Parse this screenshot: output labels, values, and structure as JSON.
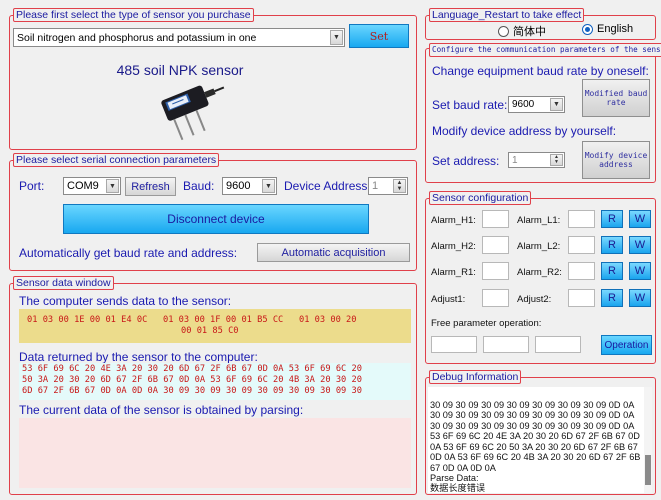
{
  "sensor_type_group": {
    "title": "Please first select the type of sensor you purchase",
    "sensor_select_value": "Soil nitrogen and phosphorus and potassium in one",
    "set_button": "Set",
    "sensor_name": "485 soil NPK sensor"
  },
  "serial_group": {
    "title": "Please select serial connection parameters",
    "port_label": "Port:",
    "port_value": "COM9",
    "refresh_button": "Refresh",
    "baud_label": "Baud:",
    "baud_value": "9600",
    "device_address_label": "Device Address:",
    "device_address_value": "1",
    "disconnect_button": "Disconnect device",
    "auto_label": "Automatically get baud rate and address:",
    "auto_button": "Automatic acquisition"
  },
  "data_window": {
    "title": "Sensor data window",
    "sent_label": "The computer sends data to the sensor:",
    "sent_line1": "01 03 00 1E 00 01 E4 0C   01 03 00 1F 00 01 B5 CC   01 03 00 20",
    "sent_line2": "00 01 85 C0",
    "returned_label": "Data returned by the sensor to the computer:",
    "returned_line1": "53 6F 69 6C 20 4E 3A 20 30 20 6D 67 2F 6B 67 0D 0A 53 6F 69 6C 20",
    "returned_line2": "50 3A 20 30 20 6D 67 2F 6B 67 0D 0A 53 6F 69 6C 20 4B 3A 20 30 20",
    "returned_line3": "6D 67 2F 6B 67 0D 0A 0D 0A 30 09 30 09 30 09 30 09 30 09 30 09 30",
    "parsed_label": "The current data of the sensor is obtained by parsing:"
  },
  "language_group": {
    "title": "Language_Restart to take effect",
    "option_chinese": "简体中",
    "option_english": "English",
    "selected": "English"
  },
  "comm_group": {
    "title": "Configure the communication parameters of the sensor",
    "baud_heading": "Change equipment baud rate by oneself:",
    "set_baud_label": "Set baud rate:",
    "set_baud_value": "9600",
    "modify_baud_button": "Modified baud rate",
    "address_heading": "Modify device address by yourself:",
    "set_address_label": "Set address:",
    "set_address_value": "1",
    "modify_address_button": "Modify device address"
  },
  "config_group": {
    "title": "Sensor configuration",
    "alarm_h1": "Alarm_H1:",
    "alarm_l1": "Alarm_L1:",
    "alarm_h2": "Alarm_H2:",
    "alarm_l2": "Alarm_L2:",
    "alarm_r1": "Alarm_R1:",
    "alarm_r2": "Alarm_R2:",
    "adjust1": "Adjust1:",
    "adjust2": "Adjust2:",
    "r_label": "R",
    "w_label": "W",
    "free_param_label": "Free parameter operation:",
    "operation_button": "Operation"
  },
  "debug_group": {
    "title": "Debug Information",
    "lines": [
      "30 09 30 09 30 09 30 09 30 09 30 09 30 09 0D 0A",
      "30 09 30 09 30 09 30 09 30 09 30 09 30 09 0D 0A",
      "30 09 30 09 30 09 30 09 30 09 30 09 30 09 0D 0A",
      "53 6F 69 6C 20 4E 3A 20 30 20 6D 67 2F 6B 67 0D",
      "0A 53 6F 69 6C 20 50 3A 20 30 20 6D 67 2F 6B 67",
      "0D 0A 53 6F 69 6C 20 4B 3A 20 30 20 6D 67 2F 6B",
      "67 0D 0A 0D 0A",
      "Parse Data:",
      "数据长度错误"
    ]
  },
  "colors": {
    "group_border": "#e0404a",
    "title_text": "#1a1aa0",
    "sent_bg": "#ecdc8c",
    "returned_bg": "#e4fafa",
    "parsed_bg": "#fae4e4",
    "hex_text": "#c81818"
  }
}
